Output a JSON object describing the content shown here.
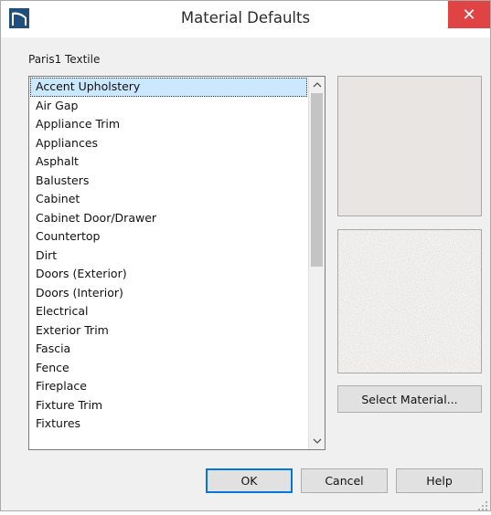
{
  "window": {
    "title": "Material Defaults",
    "close_symbol": "✕"
  },
  "group_label": "Paris1 Textile",
  "materials": [
    "Accent Upholstery",
    "Air Gap",
    "Appliance Trim",
    "Appliances",
    "Asphalt",
    "Balusters",
    "Cabinet",
    "Cabinet Door/Drawer",
    "Countertop",
    "Dirt",
    "Doors (Exterior)",
    "Doors (Interior)",
    "Electrical",
    "Exterior Trim",
    "Fascia",
    "Fence",
    "Fireplace",
    "Fixture Trim",
    "Fixtures"
  ],
  "selected_material": "Accent Upholstery",
  "buttons": {
    "select_material": "Select Material...",
    "ok": "OK",
    "cancel": "Cancel",
    "help": "Help"
  },
  "icons": {
    "app": "chief-architect-logo-icon",
    "close": "close-icon",
    "scroll_up": "scroll-up-arrow-icon",
    "scroll_down": "scroll-down-arrow-icon"
  },
  "colors": {
    "close_button": "#e04343",
    "selection": "#cce8ff",
    "swatch_top": "#e8e5e3",
    "default_button_border": "#0078d7"
  }
}
